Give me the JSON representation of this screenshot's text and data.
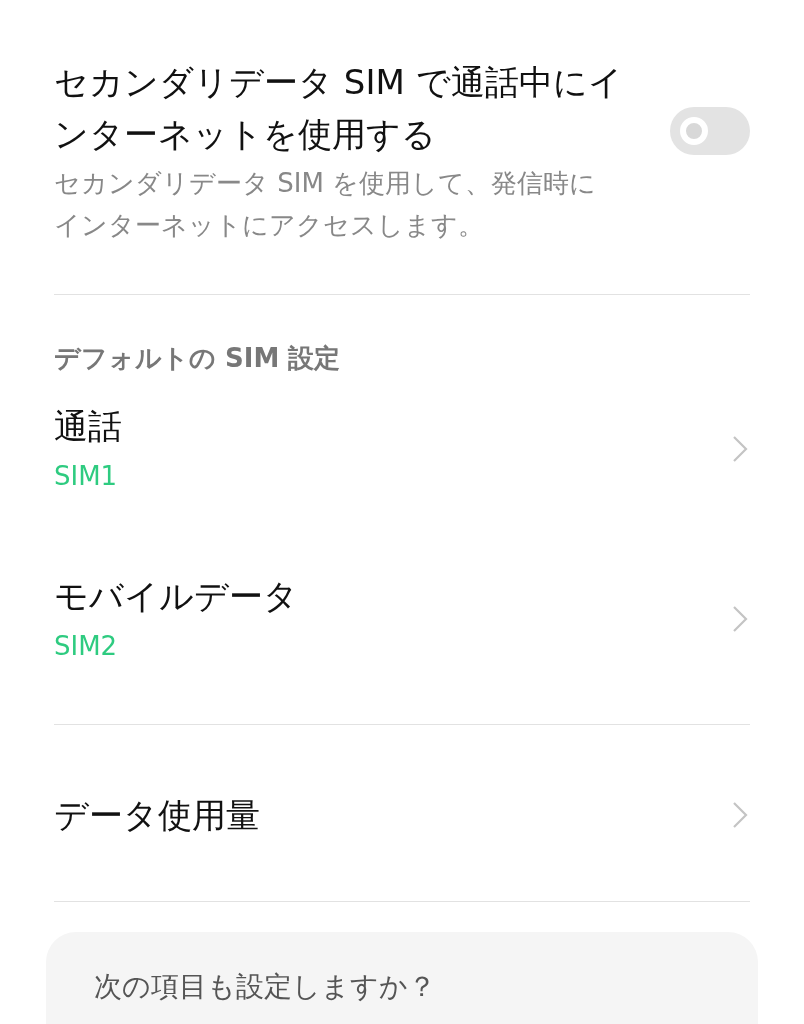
{
  "toggle_setting": {
    "title": "セカンダリデータ SIM で通話中にインターネットを使用する",
    "description": "セカンダリデータ SIM を使用して、発信時にインターネットにアクセスします。",
    "on": false
  },
  "section": {
    "header": "デフォルトの SIM 設定",
    "items": [
      {
        "label": "通話",
        "value": "SIM1"
      },
      {
        "label": "モバイルデータ",
        "value": "SIM2"
      }
    ]
  },
  "data_usage": {
    "label": "データ使用量"
  },
  "suggestion_card": {
    "title": "次の項目も設定しますか？"
  }
}
